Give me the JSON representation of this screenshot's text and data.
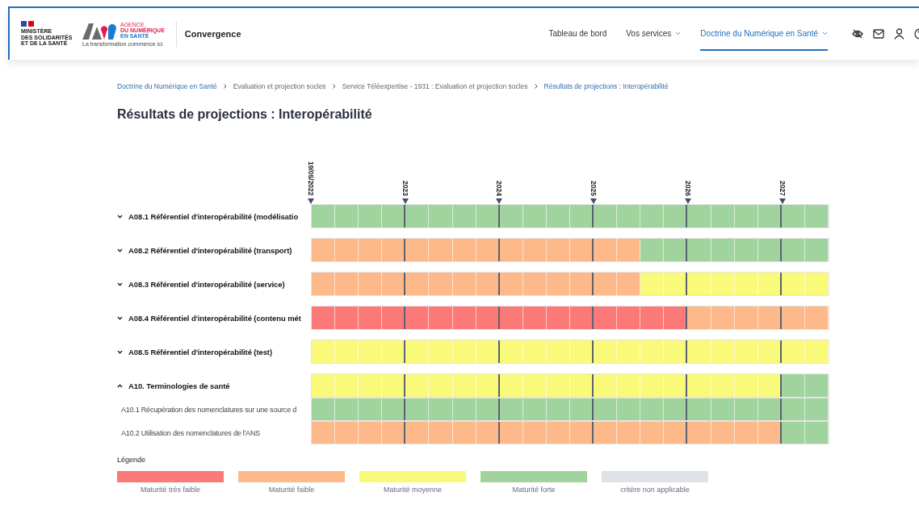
{
  "header": {
    "ministry": "MINISTÈRE\nDES SOLIDARITÉS\nET DE LA SANTÉ",
    "agency_lines": [
      "AGENCE",
      "DU NUMÉRIQUE",
      "EN SANTÉ"
    ],
    "agency_tagline": "La transformation commence ici",
    "app_name": "Convergence",
    "nav": [
      {
        "label": "Tableau de bord",
        "dropdown": false,
        "selected": false
      },
      {
        "label": "Vos services",
        "dropdown": true,
        "selected": false
      },
      {
        "label": "Doctrine du Numérique en Santé",
        "dropdown": true,
        "selected": true
      }
    ]
  },
  "breadcrumb": [
    {
      "label": "Doctrine du Numérique en Santé",
      "link": true
    },
    {
      "label": "Evaluation et projection socles",
      "link": false
    },
    {
      "label": "Service Téléexpertise - 1931 : Evaluation et projection socles",
      "link": false
    },
    {
      "label": "Résultats de projections : Interopérabilité",
      "link": true
    }
  ],
  "title": "Résultats de projections : Interopérabilité",
  "timeline": [
    "19/05/2022",
    "2023",
    "2024",
    "2025",
    "2026",
    "2027"
  ],
  "rows": [
    {
      "label": "A08.1 Référentiel d'interopérabilité (modélisatio",
      "expanded": false,
      "cells": [
        {
          "color": "#a1d39f"
        },
        {
          "color": "#a1d39f"
        },
        {
          "color": "#a1d39f"
        },
        {
          "color": "#a1d39f"
        },
        {
          "color": "#a1d39f"
        },
        {
          "color": "#a1d39f"
        },
        {
          "color": "#a1d39f"
        },
        {
          "color": "#a1d39f"
        },
        {
          "color": "#a1d39f"
        },
        {
          "color": "#a1d39f"
        },
        {
          "color": "#a1d39f"
        },
        {
          "color": "#a1d39f"
        },
        {
          "color": "#a1d39f"
        },
        {
          "color": "#a1d39f"
        },
        {
          "color": "#a1d39f"
        },
        {
          "color": "#a1d39f"
        },
        {
          "color": "#a1d39f"
        },
        {
          "color": "#a1d39f"
        },
        {
          "color": "#a1d39f"
        },
        {
          "color": "#a1d39f"
        },
        {
          "color": "#a1d39f"
        },
        {
          "color": "#a1d39f"
        }
      ]
    },
    {
      "label": "A08.2 Référentiel d'interopérabilité (transport)",
      "expanded": false,
      "cells": [
        {
          "color": "#fdb98a"
        },
        {
          "color": "#fdb98a"
        },
        {
          "color": "#fdb98a"
        },
        {
          "color": "#fdb98a"
        },
        {
          "color": "#fdb98a"
        },
        {
          "color": "#fdb98a"
        },
        {
          "color": "#fdb98a"
        },
        {
          "color": "#fdb98a"
        },
        {
          "color": "#fdb98a"
        },
        {
          "color": "#fdb98a"
        },
        {
          "color": "#fdb98a"
        },
        {
          "color": "#fdb98a"
        },
        {
          "color": "#fdb98a"
        },
        {
          "color": "#fdb98a"
        },
        {
          "color": "#a1d39f"
        },
        {
          "color": "#a1d39f"
        },
        {
          "color": "#a1d39f"
        },
        {
          "color": "#a1d39f"
        },
        {
          "color": "#a1d39f"
        },
        {
          "color": "#a1d39f"
        },
        {
          "color": "#a1d39f"
        },
        {
          "color": "#a1d39f"
        }
      ]
    },
    {
      "label": "A08.3 Référentiel d'interopérabilité (service)",
      "expanded": false,
      "cells": [
        {
          "color": "#fdb98a"
        },
        {
          "color": "#fdb98a"
        },
        {
          "color": "#fdb98a"
        },
        {
          "color": "#fdb98a"
        },
        {
          "color": "#fdb98a"
        },
        {
          "color": "#fdb98a"
        },
        {
          "color": "#fdb98a"
        },
        {
          "color": "#fdb98a"
        },
        {
          "color": "#fdb98a"
        },
        {
          "color": "#fdb98a"
        },
        {
          "color": "#fdb98a"
        },
        {
          "color": "#fdb98a"
        },
        {
          "color": "#fdb98a"
        },
        {
          "color": "#fdb98a"
        },
        {
          "color": "#fafa7a"
        },
        {
          "color": "#fafa7a"
        },
        {
          "color": "#fafa7a"
        },
        {
          "color": "#fafa7a"
        },
        {
          "color": "#fafa7a"
        },
        {
          "color": "#fafa7a"
        },
        {
          "color": "#fafa7a"
        },
        {
          "color": "#fafa7a"
        }
      ]
    },
    {
      "label": "A08.4 Référentiel d'interopérabilité (contenu mét",
      "expanded": false,
      "cells": [
        {
          "color": "#fb7a78"
        },
        {
          "color": "#fb7a78"
        },
        {
          "color": "#fb7a78"
        },
        {
          "color": "#fb7a78"
        },
        {
          "color": "#fb7a78"
        },
        {
          "color": "#fb7a78"
        },
        {
          "color": "#fb7a78"
        },
        {
          "color": "#fb7a78"
        },
        {
          "color": "#fb7a78"
        },
        {
          "color": "#fb7a78"
        },
        {
          "color": "#fb7a78"
        },
        {
          "color": "#fb7a78"
        },
        {
          "color": "#fb7a78"
        },
        {
          "color": "#fb7a78"
        },
        {
          "color": "#fb7a78"
        },
        {
          "color": "#fb7a78"
        },
        {
          "color": "#fdb98a"
        },
        {
          "color": "#fdb98a"
        },
        {
          "color": "#fdb98a"
        },
        {
          "color": "#fdb98a"
        },
        {
          "color": "#fdb98a"
        },
        {
          "color": "#fdb98a"
        }
      ]
    },
    {
      "label": "A08.5 Référentiel d'interopérabilité (test)",
      "expanded": false,
      "cells": [
        {
          "color": "#fafa7a"
        },
        {
          "color": "#fafa7a"
        },
        {
          "color": "#fafa7a"
        },
        {
          "color": "#fafa7a"
        },
        {
          "color": "#fafa7a"
        },
        {
          "color": "#fafa7a"
        },
        {
          "color": "#fafa7a"
        },
        {
          "color": "#fafa7a"
        },
        {
          "color": "#fafa7a"
        },
        {
          "color": "#fafa7a"
        },
        {
          "color": "#fafa7a"
        },
        {
          "color": "#fafa7a"
        },
        {
          "color": "#fafa7a"
        },
        {
          "color": "#fafa7a"
        },
        {
          "color": "#fafa7a"
        },
        {
          "color": "#fafa7a"
        },
        {
          "color": "#fafa7a"
        },
        {
          "color": "#fafa7a"
        },
        {
          "color": "#fafa7a"
        },
        {
          "color": "#fafa7a"
        },
        {
          "color": "#fafa7a"
        },
        {
          "color": "#fafa7a"
        }
      ]
    },
    {
      "label": "A10. Terminologies de santé",
      "expanded": true,
      "cells": [
        {
          "color": "#fafa7a"
        },
        {
          "color": "#fafa7a"
        },
        {
          "color": "#fafa7a"
        },
        {
          "color": "#fafa7a"
        },
        {
          "color": "#fafa7a"
        },
        {
          "color": "#fafa7a"
        },
        {
          "color": "#fafa7a"
        },
        {
          "color": "#fafa7a"
        },
        {
          "color": "#fafa7a"
        },
        {
          "color": "#fafa7a"
        },
        {
          "color": "#fafa7a"
        },
        {
          "color": "#fafa7a"
        },
        {
          "color": "#fafa7a"
        },
        {
          "color": "#fafa7a"
        },
        {
          "color": "#fafa7a"
        },
        {
          "color": "#fafa7a"
        },
        {
          "color": "#fafa7a"
        },
        {
          "color": "#fafa7a"
        },
        {
          "color": "#fafa7a"
        },
        {
          "color": "#fafa7a"
        },
        {
          "color": "#a1d39f"
        },
        {
          "color": "#a1d39f"
        }
      ],
      "children": [
        {
          "label": "A10.1 Récupération des nomenclatures sur une source d",
          "cells": [
            {
              "color": "#a1d39f"
            },
            {
              "color": "#a1d39f"
            },
            {
              "color": "#a1d39f"
            },
            {
              "color": "#a1d39f"
            },
            {
              "color": "#a1d39f"
            },
            {
              "color": "#a1d39f"
            },
            {
              "color": "#a1d39f"
            },
            {
              "color": "#a1d39f"
            },
            {
              "color": "#a1d39f"
            },
            {
              "color": "#a1d39f"
            },
            {
              "color": "#a1d39f"
            },
            {
              "color": "#a1d39f"
            },
            {
              "color": "#a1d39f"
            },
            {
              "color": "#a1d39f"
            },
            {
              "color": "#a1d39f"
            },
            {
              "color": "#a1d39f"
            },
            {
              "color": "#a1d39f"
            },
            {
              "color": "#a1d39f"
            },
            {
              "color": "#a1d39f"
            },
            {
              "color": "#a1d39f"
            },
            {
              "color": "#a1d39f"
            },
            {
              "color": "#a1d39f"
            }
          ]
        },
        {
          "label": "A10.2 Utilisation des nomenclatures de l'ANS",
          "cells": [
            {
              "color": "#fdb98a"
            },
            {
              "color": "#fdb98a"
            },
            {
              "color": "#fdb98a"
            },
            {
              "color": "#fdb98a"
            },
            {
              "color": "#fdb98a"
            },
            {
              "color": "#fdb98a"
            },
            {
              "color": "#fdb98a"
            },
            {
              "color": "#fdb98a"
            },
            {
              "color": "#fdb98a"
            },
            {
              "color": "#fdb98a"
            },
            {
              "color": "#fdb98a"
            },
            {
              "color": "#fdb98a"
            },
            {
              "color": "#fdb98a"
            },
            {
              "color": "#fdb98a"
            },
            {
              "color": "#fdb98a"
            },
            {
              "color": "#fdb98a"
            },
            {
              "color": "#fdb98a"
            },
            {
              "color": "#fdb98a"
            },
            {
              "color": "#fdb98a"
            },
            {
              "color": "#fdb98a"
            },
            {
              "color": "#a1d39f"
            },
            {
              "color": "#a1d39f"
            }
          ]
        }
      ]
    }
  ],
  "legend": {
    "title": "Légende",
    "items": [
      {
        "label": "Maturité très faible",
        "color": "#fb7a78"
      },
      {
        "label": "Maturité faible",
        "color": "#fdb98a"
      },
      {
        "label": "Maturité moyenne",
        "color": "#fafa7a"
      },
      {
        "label": "Maturité forte",
        "color": "#a1d39f"
      },
      {
        "label": "critère non applicable",
        "color": "#dfe1e8"
      }
    ]
  }
}
